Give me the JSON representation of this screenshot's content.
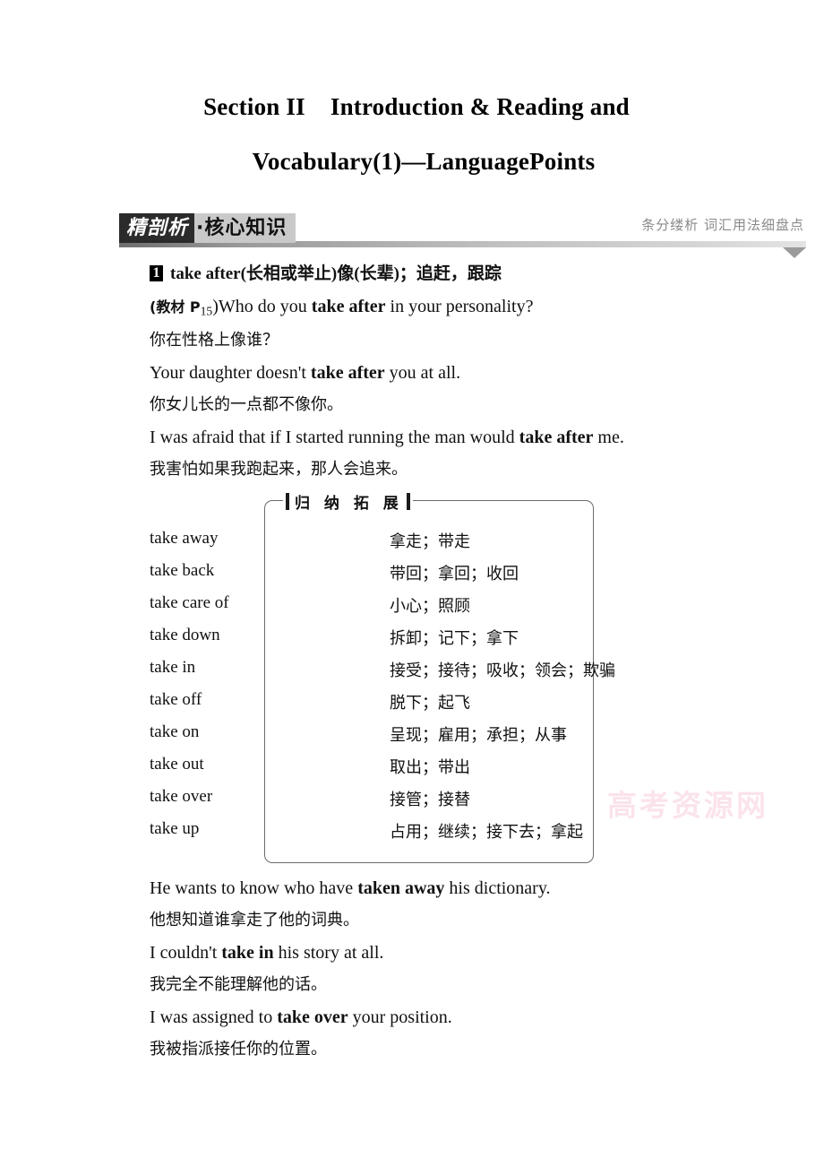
{
  "title": {
    "line1_a": "Section II",
    "line1_b": "Introduction & Reading and",
    "line2": "Vocabulary(1)—LanguagePoints"
  },
  "banner": {
    "badge_dark": "精剖析",
    "badge_light": "·核心知识",
    "caption": "条分缕析 词汇用法细盘点",
    "arrow_icon": "triangle-down-icon"
  },
  "entry": {
    "number": "1",
    "headword_en": "take after",
    "headword_cn": "(长相或举止)像(长辈)；追赶，跟踪",
    "examples": [
      {
        "prefix": "(教材 P",
        "sub": "15",
        "prefix_end": ")",
        "pre": "Who do you ",
        "bold": "take after",
        "post": " in your personality?"
      },
      {
        "cn": "你在性格上像谁？"
      },
      {
        "pre": "Your daughter doesn't ",
        "bold": "take after",
        "post": " you at all."
      },
      {
        "cn": "你女儿长的一点都不像你。"
      },
      {
        "pre": "I was afraid that if I started running the man would ",
        "bold": "take after",
        "post": " me."
      },
      {
        "cn": "我害怕如果我跑起来，那人会追来。"
      }
    ]
  },
  "expand_box": {
    "label": "归 纳 拓 展",
    "columns": [
      "phrase",
      "meaning"
    ],
    "rows": [
      {
        "phrase": "take away",
        "meaning": "拿走；带走"
      },
      {
        "phrase": "take back",
        "meaning": "带回；拿回；收回"
      },
      {
        "phrase": "take care of",
        "meaning": "小心；照顾"
      },
      {
        "phrase": "take down",
        "meaning": "拆卸；记下；拿下"
      },
      {
        "phrase": "take in",
        "meaning": "接受；接待；吸收；领会；欺骗"
      },
      {
        "phrase": "take off",
        "meaning": "脱下；起飞"
      },
      {
        "phrase": "take on",
        "meaning": "呈现；雇用；承担；从事"
      },
      {
        "phrase": "take out",
        "meaning": "取出；带出"
      },
      {
        "phrase": "take over",
        "meaning": "接管；接替"
      },
      {
        "phrase": "take up",
        "meaning": "占用；继续；接下去；拿起"
      }
    ]
  },
  "bottom_examples": [
    {
      "pre": "He wants to know who have ",
      "bold": "taken away",
      "post": " his dictionary."
    },
    {
      "cn": "他想知道谁拿走了他的词典。"
    },
    {
      "pre": "I couldn't ",
      "bold": "take in",
      "post": " his story at all."
    },
    {
      "cn": "我完全不能理解他的话。"
    },
    {
      "pre": "I was assigned to ",
      "bold": "take over",
      "post": " your position."
    },
    {
      "cn": "我被指派接任你的位置。"
    }
  ],
  "watermark": "高考资源网"
}
